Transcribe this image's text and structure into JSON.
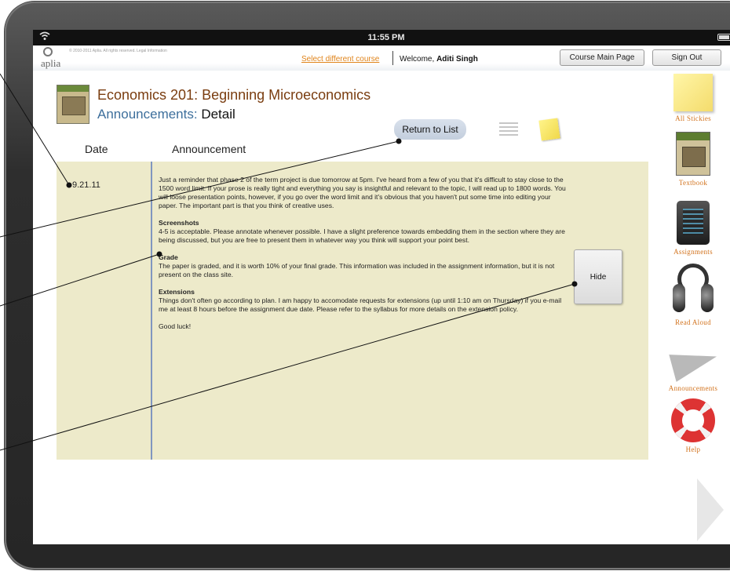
{
  "status_bar": {
    "time": "11:55 PM"
  },
  "header": {
    "logo_text": "aplia",
    "copyright": "© 2010-2011 Aplia. All rights reserved. Legal Information",
    "select_course": "Select different course",
    "welcome_prefix": "Welcome,",
    "user_name": "Aditi Singh",
    "course_main_button": "Course Main Page",
    "sign_out_button": "Sign Out"
  },
  "page": {
    "course_title": "Economics 201: Beginning Microeconomics",
    "section_label": "Announcements:",
    "section_detail": "Detail",
    "return_button": "Return to List",
    "col_date": "Date",
    "col_announcement": "Announcement"
  },
  "announcement": {
    "date": "9.21.11",
    "intro": "Just a reminder that phase 2 of the term project is due tomorrow at 5pm. I've heard from a few of you that it's difficult to stay close to the 1500 word limit. If your prose is really tight and everything you say is insightful and relevant to the topic, I will read up to 1800 words. You will loose presentation points, however, if you go over the word limit and it's obvious that you haven't put some time into editing your paper. The important part is that you think of creative uses.",
    "screenshots_head": "Screenshots",
    "screenshots_body": "4-5 is acceptable. Please annotate whenever possible. I have a slight preference towards embedding them in the section where they are being discussed, but you are free to present them in whatever way you think will support your point best.",
    "grade_head": "Grade",
    "grade_body": "The paper is graded, and it is worth 10% of your final grade. This information was included in the assignment information, but it is not present on the class site.",
    "extensions_head": "Extensions",
    "extensions_body": "Things don't often go according to plan. I am happy to accomodate requests for extensions (up until 1:10 am on Thursday) if you e-mail me at least 8 hours before the assignment due date. Please refer to the syllabus for more details on the extension policy.",
    "closing": "Good luck!",
    "hide_button": "Hide"
  },
  "sidebar": {
    "items": [
      {
        "label": "All Stickies",
        "icon": "sticky-note-icon"
      },
      {
        "label": "Textbook",
        "icon": "textbook-icon"
      },
      {
        "label": "Assignments",
        "icon": "assignments-icon"
      },
      {
        "label": "Read Aloud",
        "icon": "headphones-icon"
      },
      {
        "label": "Announcements",
        "icon": "megaphone-icon"
      },
      {
        "label": "Help",
        "icon": "life-ring-icon"
      }
    ]
  },
  "colors": {
    "course_title": "#7a3d10",
    "section_blue": "#3d6f9c",
    "sidebar_label": "#d2731e",
    "panel_bg": "#edeaca",
    "link_orange": "#e0841b"
  }
}
